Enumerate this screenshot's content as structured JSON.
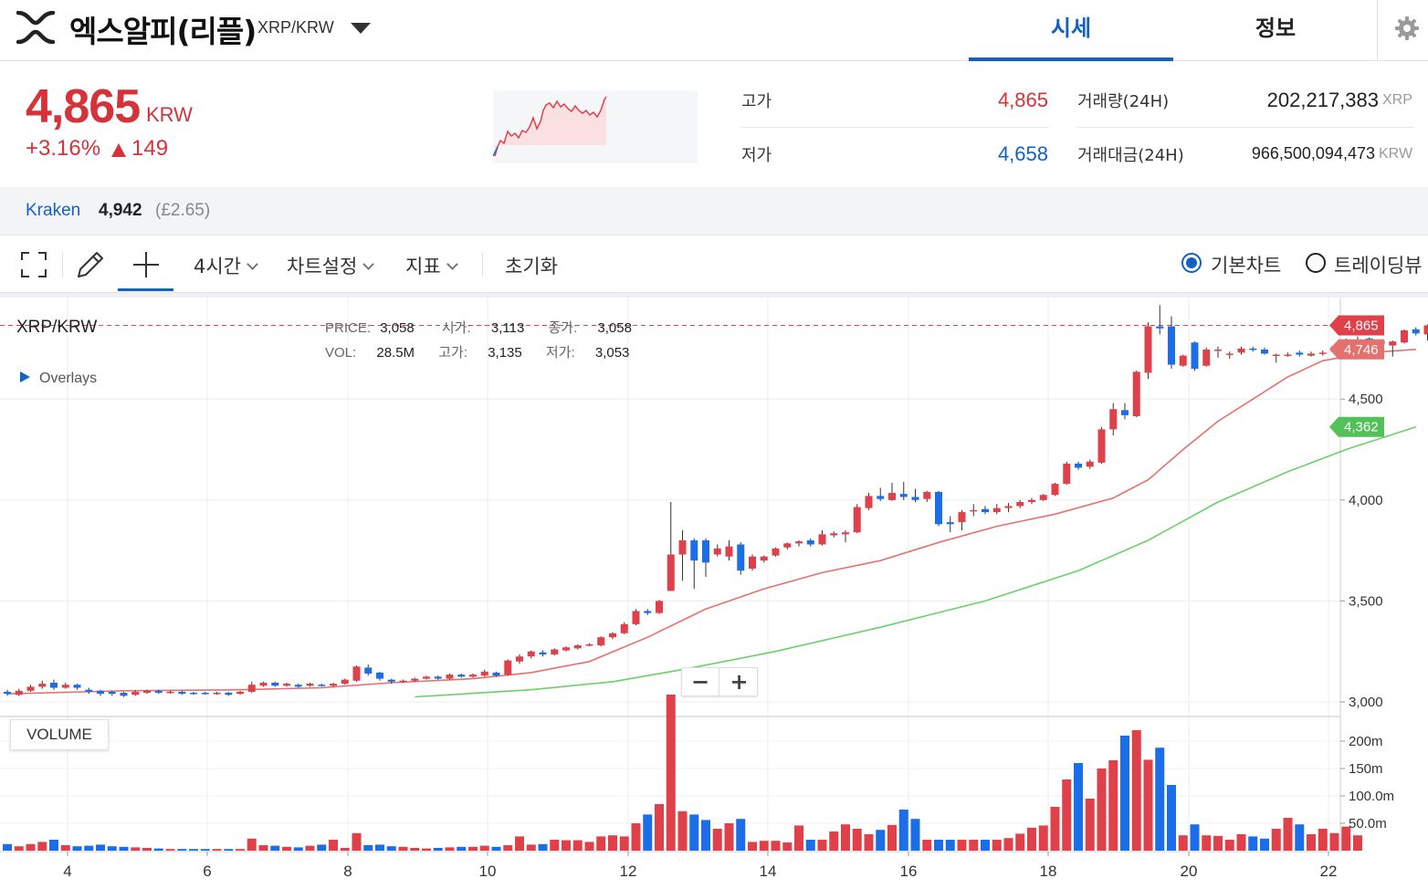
{
  "header": {
    "coin_name": "엑스알피(리플)",
    "pair": "XRP/KRW",
    "tabs": [
      {
        "label": "시세",
        "active": true
      },
      {
        "label": "정보",
        "active": false
      }
    ],
    "icons": [
      "xrp-logo-icon",
      "dropdown-caret-icon",
      "gear-icon"
    ]
  },
  "summary": {
    "price": "4,865",
    "price_unit": "KRW",
    "change_rate": "+3.16%",
    "change_amount": "149",
    "high_label": "고가",
    "high_value": "4,865",
    "low_label": "저가",
    "low_value": "4,658",
    "volume_label": "거래량(24H)",
    "volume_value": "202,217,383",
    "volume_unit": "XRP",
    "amount_label": "거래대금(24H)",
    "amount_value": "966,500,094,473",
    "amount_unit": "KRW"
  },
  "exchange": {
    "name": "Kraken",
    "price": "4,942",
    "gbp": "(£2.65)"
  },
  "toolbar": {
    "interval": "4시간",
    "chart_settings": "차트설정",
    "indicators": "지표",
    "reset": "초기화",
    "basic_chart": "기본차트",
    "trading_view": "트레이딩뷰",
    "selected_view": "기본차트",
    "icons": [
      "fullscreen-icon",
      "pencil-icon",
      "crosshair-icon"
    ]
  },
  "legend": {
    "pair": "XRP/KRW",
    "price_label": "PRICE:",
    "price": "3,058",
    "open_label": "시가:",
    "open": "3,113",
    "close_label": "종가:",
    "close": "3,058",
    "vol_label": "VOL:",
    "vol": "28.5M",
    "high_label": "고가:",
    "high": "3,135",
    "low_label": "저가:",
    "low": "3,053",
    "overlays": "Overlays"
  },
  "volume_tag": "VOLUME",
  "zoom": {
    "minus": "−",
    "plus": "+"
  },
  "colors": {
    "up": "#e0404a",
    "down": "#1b6ee8",
    "accent": "#1261c4",
    "ma_short": "#e3726e",
    "ma_long": "#6cd06a"
  },
  "chart_data": {
    "type": "candlestick",
    "price_axis_ticks": [
      "4,500",
      "4,000",
      "3,500",
      "3,000"
    ],
    "volume_axis_ticks": [
      "200m",
      "150m",
      "100.0m",
      "50.0m"
    ],
    "x_ticks": [
      "4",
      "6",
      "8",
      "10",
      "12",
      "14",
      "16",
      "18",
      "20",
      "22"
    ],
    "price_badges": [
      {
        "value": "4,865",
        "color": "#e0404a"
      },
      {
        "value": "4,746",
        "color": "#e3726e"
      },
      {
        "value": "4,362",
        "color": "#53c05a"
      }
    ],
    "ylim": [
      2990,
      5000
    ],
    "candles": [
      {
        "o": 3050,
        "c": 3040,
        "h": 3060,
        "l": 3030
      },
      {
        "o": 3035,
        "c": 3055,
        "h": 3065,
        "l": 3030
      },
      {
        "o": 3055,
        "c": 3075,
        "h": 3085,
        "l": 3050
      },
      {
        "o": 3075,
        "c": 3090,
        "h": 3105,
        "l": 3065
      },
      {
        "o": 3095,
        "c": 3070,
        "h": 3110,
        "l": 3060
      },
      {
        "o": 3070,
        "c": 3085,
        "h": 3095,
        "l": 3065
      },
      {
        "o": 3085,
        "c": 3070,
        "h": 3090,
        "l": 3060
      },
      {
        "o": 3060,
        "c": 3050,
        "h": 3070,
        "l": 3040
      },
      {
        "o": 3055,
        "c": 3040,
        "h": 3060,
        "l": 3030
      },
      {
        "o": 3050,
        "c": 3040,
        "h": 3055,
        "l": 3030
      },
      {
        "o": 3045,
        "c": 3030,
        "h": 3050,
        "l": 3025
      },
      {
        "o": 3035,
        "c": 3050,
        "h": 3058,
        "l": 3030
      },
      {
        "o": 3045,
        "c": 3055,
        "h": 3060,
        "l": 3040
      },
      {
        "o": 3055,
        "c": 3045,
        "h": 3060,
        "l": 3040
      },
      {
        "o": 3045,
        "c": 3050,
        "h": 3056,
        "l": 3040
      },
      {
        "o": 3050,
        "c": 3040,
        "h": 3056,
        "l": 3035
      },
      {
        "o": 3045,
        "c": 3040,
        "h": 3050,
        "l": 3035
      },
      {
        "o": 3045,
        "c": 3040,
        "h": 3050,
        "l": 3035
      },
      {
        "o": 3040,
        "c": 3045,
        "h": 3050,
        "l": 3035
      },
      {
        "o": 3045,
        "c": 3035,
        "h": 3050,
        "l": 3030
      },
      {
        "o": 3040,
        "c": 3050,
        "h": 3055,
        "l": 3035
      },
      {
        "o": 3050,
        "c": 3085,
        "h": 3100,
        "l": 3045
      },
      {
        "o": 3080,
        "c": 3095,
        "h": 3100,
        "l": 3075
      },
      {
        "o": 3095,
        "c": 3080,
        "h": 3100,
        "l": 3075
      },
      {
        "o": 3080,
        "c": 3090,
        "h": 3095,
        "l": 3075
      },
      {
        "o": 3085,
        "c": 3075,
        "h": 3090,
        "l": 3070
      },
      {
        "o": 3080,
        "c": 3090,
        "h": 3095,
        "l": 3075
      },
      {
        "o": 3085,
        "c": 3080,
        "h": 3090,
        "l": 3075
      },
      {
        "o": 3080,
        "c": 3090,
        "h": 3095,
        "l": 3075
      },
      {
        "o": 3090,
        "c": 3110,
        "h": 3115,
        "l": 3085
      },
      {
        "o": 3105,
        "c": 3175,
        "h": 3180,
        "l": 3100
      },
      {
        "o": 3170,
        "c": 3140,
        "h": 3185,
        "l": 3130
      },
      {
        "o": 3145,
        "c": 3115,
        "h": 3150,
        "l": 3105
      },
      {
        "o": 3110,
        "c": 3100,
        "h": 3115,
        "l": 3090
      },
      {
        "o": 3100,
        "c": 3105,
        "h": 3110,
        "l": 3095
      },
      {
        "o": 3105,
        "c": 3115,
        "h": 3120,
        "l": 3100
      },
      {
        "o": 3115,
        "c": 3125,
        "h": 3130,
        "l": 3110
      },
      {
        "o": 3125,
        "c": 3115,
        "h": 3130,
        "l": 3110
      },
      {
        "o": 3115,
        "c": 3135,
        "h": 3140,
        "l": 3110
      },
      {
        "o": 3135,
        "c": 3125,
        "h": 3140,
        "l": 3120
      },
      {
        "o": 3125,
        "c": 3135,
        "h": 3140,
        "l": 3120
      },
      {
        "o": 3130,
        "c": 3150,
        "h": 3160,
        "l": 3125
      },
      {
        "o": 3145,
        "c": 3130,
        "h": 3150,
        "l": 3125
      },
      {
        "o": 3135,
        "c": 3205,
        "h": 3210,
        "l": 3130
      },
      {
        "o": 3200,
        "c": 3225,
        "h": 3235,
        "l": 3190
      },
      {
        "o": 3225,
        "c": 3250,
        "h": 3255,
        "l": 3215
      },
      {
        "o": 3245,
        "c": 3235,
        "h": 3255,
        "l": 3225
      },
      {
        "o": 3235,
        "c": 3260,
        "h": 3265,
        "l": 3230
      },
      {
        "o": 3255,
        "c": 3270,
        "h": 3275,
        "l": 3250
      },
      {
        "o": 3265,
        "c": 3280,
        "h": 3285,
        "l": 3260
      },
      {
        "o": 3280,
        "c": 3285,
        "h": 3290,
        "l": 3275
      },
      {
        "o": 3280,
        "c": 3320,
        "h": 3325,
        "l": 3275
      },
      {
        "o": 3320,
        "c": 3340,
        "h": 3345,
        "l": 3310
      },
      {
        "o": 3340,
        "c": 3385,
        "h": 3395,
        "l": 3335
      },
      {
        "o": 3385,
        "c": 3450,
        "h": 3460,
        "l": 3380
      },
      {
        "o": 3450,
        "c": 3440,
        "h": 3460,
        "l": 3430
      },
      {
        "o": 3440,
        "c": 3500,
        "h": 3505,
        "l": 3435
      },
      {
        "o": 3550,
        "c": 3730,
        "h": 3990,
        "l": 3550
      },
      {
        "o": 3730,
        "c": 3800,
        "h": 3850,
        "l": 3600
      },
      {
        "o": 3800,
        "c": 3700,
        "h": 3810,
        "l": 3560
      },
      {
        "o": 3800,
        "c": 3690,
        "h": 3810,
        "l": 3620
      },
      {
        "o": 3730,
        "c": 3760,
        "h": 3780,
        "l": 3720
      },
      {
        "o": 3720,
        "c": 3770,
        "h": 3800,
        "l": 3700
      },
      {
        "o": 3780,
        "c": 3650,
        "h": 3790,
        "l": 3630
      },
      {
        "o": 3660,
        "c": 3720,
        "h": 3730,
        "l": 3650
      },
      {
        "o": 3700,
        "c": 3720,
        "h": 3725,
        "l": 3690
      },
      {
        "o": 3725,
        "c": 3760,
        "h": 3765,
        "l": 3720
      },
      {
        "o": 3765,
        "c": 3785,
        "h": 3790,
        "l": 3755
      },
      {
        "o": 3785,
        "c": 3795,
        "h": 3800,
        "l": 3770
      },
      {
        "o": 3800,
        "c": 3780,
        "h": 3810,
        "l": 3770
      },
      {
        "o": 3780,
        "c": 3830,
        "h": 3850,
        "l": 3775
      },
      {
        "o": 3825,
        "c": 3835,
        "h": 3845,
        "l": 3815
      },
      {
        "o": 3830,
        "c": 3840,
        "h": 3850,
        "l": 3790
      },
      {
        "o": 3840,
        "c": 3965,
        "h": 3980,
        "l": 3835
      },
      {
        "o": 3960,
        "c": 4020,
        "h": 4035,
        "l": 3950
      },
      {
        "o": 4020,
        "c": 4005,
        "h": 4060,
        "l": 3995
      },
      {
        "o": 4000,
        "c": 4035,
        "h": 4085,
        "l": 3995
      },
      {
        "o": 4030,
        "c": 4015,
        "h": 4090,
        "l": 4000
      },
      {
        "o": 4015,
        "c": 4000,
        "h": 4055,
        "l": 3990
      },
      {
        "o": 4005,
        "c": 4040,
        "h": 4045,
        "l": 3990
      },
      {
        "o": 4040,
        "c": 3880,
        "h": 4045,
        "l": 3870
      },
      {
        "o": 3890,
        "c": 3880,
        "h": 3920,
        "l": 3840
      },
      {
        "o": 3890,
        "c": 3940,
        "h": 3950,
        "l": 3850
      },
      {
        "o": 3945,
        "c": 3950,
        "h": 3980,
        "l": 3920
      },
      {
        "o": 3955,
        "c": 3940,
        "h": 3970,
        "l": 3930
      },
      {
        "o": 3940,
        "c": 3960,
        "h": 3980,
        "l": 3930
      },
      {
        "o": 3960,
        "c": 3970,
        "h": 3985,
        "l": 3940
      },
      {
        "o": 3970,
        "c": 3990,
        "h": 4000,
        "l": 3960
      },
      {
        "o": 3990,
        "c": 4000,
        "h": 4010,
        "l": 3980
      },
      {
        "o": 4000,
        "c": 4025,
        "h": 4030,
        "l": 3995
      },
      {
        "o": 4025,
        "c": 4080,
        "h": 4085,
        "l": 4020
      },
      {
        "o": 4080,
        "c": 4180,
        "h": 4190,
        "l": 4075
      },
      {
        "o": 4180,
        "c": 4160,
        "h": 4190,
        "l": 4150
      },
      {
        "o": 4165,
        "c": 4190,
        "h": 4200,
        "l": 4155
      },
      {
        "o": 4185,
        "c": 4350,
        "h": 4360,
        "l": 4180
      },
      {
        "o": 4350,
        "c": 4450,
        "h": 4480,
        "l": 4320
      },
      {
        "o": 4445,
        "c": 4420,
        "h": 4480,
        "l": 4400
      },
      {
        "o": 4415,
        "c": 4635,
        "h": 4640,
        "l": 4410
      },
      {
        "o": 4630,
        "c": 4860,
        "h": 4880,
        "l": 4600
      },
      {
        "o": 4860,
        "c": 4850,
        "h": 4965,
        "l": 4820
      },
      {
        "o": 4860,
        "c": 4670,
        "h": 4910,
        "l": 4650
      },
      {
        "o": 4665,
        "c": 4715,
        "h": 4720,
        "l": 4660
      },
      {
        "o": 4780,
        "c": 4650,
        "h": 4785,
        "l": 4640
      },
      {
        "o": 4665,
        "c": 4745,
        "h": 4755,
        "l": 4660
      },
      {
        "o": 4740,
        "c": 4745,
        "h": 4760,
        "l": 4705
      },
      {
        "o": 4720,
        "c": 4725,
        "h": 4735,
        "l": 4700
      },
      {
        "o": 4730,
        "c": 4750,
        "h": 4760,
        "l": 4720
      },
      {
        "o": 4750,
        "c": 4745,
        "h": 4760,
        "l": 4735
      },
      {
        "o": 4745,
        "c": 4725,
        "h": 4755,
        "l": 4720
      },
      {
        "o": 4715,
        "c": 4720,
        "h": 4725,
        "l": 4680
      },
      {
        "o": 4720,
        "c": 4720,
        "h": 4730,
        "l": 4710
      },
      {
        "o": 4730,
        "c": 4720,
        "h": 4740,
        "l": 4710
      },
      {
        "o": 4715,
        "c": 4725,
        "h": 4735,
        "l": 4710
      },
      {
        "o": 4725,
        "c": 4730,
        "h": 4740,
        "l": 4715
      },
      {
        "o": 4735,
        "c": 4760,
        "h": 4765,
        "l": 4730
      },
      {
        "o": 4765,
        "c": 4790,
        "h": 4800,
        "l": 4760
      },
      {
        "o": 4785,
        "c": 4795,
        "h": 4810,
        "l": 4770
      },
      {
        "o": 4800,
        "c": 4780,
        "h": 4805,
        "l": 4750
      },
      {
        "o": 4790,
        "c": 4770,
        "h": 4795,
        "l": 4750
      },
      {
        "o": 4765,
        "c": 4785,
        "h": 4790,
        "l": 4710
      },
      {
        "o": 4780,
        "c": 4840,
        "h": 4845,
        "l": 4775
      },
      {
        "o": 4845,
        "c": 4825,
        "h": 4855,
        "l": 4815
      },
      {
        "o": 4820,
        "c": 4865,
        "h": 4870,
        "l": 4790
      }
    ],
    "volumes": [
      12,
      8,
      12,
      16,
      20,
      10,
      8,
      9,
      11,
      8,
      7,
      6,
      5,
      4,
      3,
      3,
      3,
      3,
      3,
      3,
      3,
      22,
      10,
      9,
      7,
      6,
      9,
      11,
      20,
      5,
      32,
      10,
      11,
      8,
      7,
      5,
      4,
      5,
      6,
      7,
      7,
      9,
      7,
      10,
      26,
      11,
      12,
      20,
      19,
      19,
      16,
      26,
      28,
      26,
      50,
      66,
      85,
      285,
      72,
      66,
      56,
      40,
      50,
      58,
      16,
      18,
      18,
      15,
      46,
      20,
      20,
      35,
      48,
      40,
      30,
      38,
      47,
      75,
      58,
      20,
      20,
      20,
      20,
      20,
      20,
      20,
      23,
      31,
      42,
      46,
      80,
      130,
      160,
      95,
      150,
      165,
      210,
      220,
      166,
      188,
      120,
      28,
      48,
      28,
      27,
      20,
      30,
      26,
      22,
      40,
      60,
      48,
      30,
      40,
      32,
      44,
      28
    ],
    "ma_short": [
      [
        0,
        3040
      ],
      [
        10,
        3055
      ],
      [
        20,
        3060
      ],
      [
        27,
        3070
      ],
      [
        33,
        3095
      ],
      [
        40,
        3115
      ],
      [
        45,
        3145
      ],
      [
        50,
        3200
      ],
      [
        55,
        3320
      ],
      [
        60,
        3460
      ],
      [
        65,
        3560
      ],
      [
        70,
        3640
      ],
      [
        75,
        3700
      ],
      [
        80,
        3790
      ],
      [
        85,
        3870
      ],
      [
        90,
        3930
      ],
      [
        95,
        4010
      ],
      [
        98,
        4100
      ],
      [
        101,
        4250
      ],
      [
        104,
        4390
      ],
      [
        107,
        4500
      ],
      [
        110,
        4610
      ],
      [
        113,
        4690
      ],
      [
        117,
        4730
      ],
      [
        121,
        4746
      ]
    ],
    "ma_long": [
      [
        35,
        3025
      ],
      [
        45,
        3060
      ],
      [
        52,
        3100
      ],
      [
        58,
        3160
      ],
      [
        66,
        3250
      ],
      [
        75,
        3370
      ],
      [
        84,
        3500
      ],
      [
        92,
        3650
      ],
      [
        98,
        3800
      ],
      [
        104,
        3990
      ],
      [
        110,
        4140
      ],
      [
        115,
        4250
      ],
      [
        121,
        4362
      ]
    ]
  }
}
